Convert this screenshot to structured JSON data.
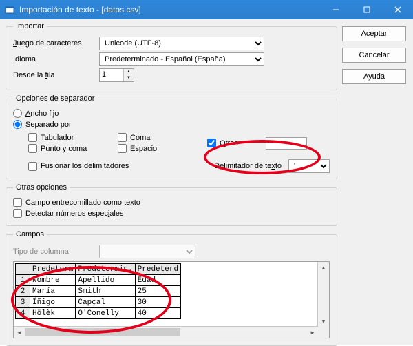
{
  "title": "Importación de texto - [datos.csv]",
  "buttons": {
    "accept": "Aceptar",
    "cancel": "Cancelar",
    "help": "Ayuda"
  },
  "import": {
    "legend": "Importar",
    "charset_label": "Juego de caracteres",
    "charset_value": "Unicode (UTF-8)",
    "lang_label": "Idioma",
    "lang_value": "Predeterminado - Español (España)",
    "fromrow_label": "Desde la fila",
    "fromrow_value": "1"
  },
  "sep": {
    "legend": "Opciones de separador",
    "fixed": "Ancho fijo",
    "by": "Separado por",
    "tab": "Tabulador",
    "comma": "Coma",
    "others": "Otros",
    "others_value": "~",
    "semicolon": "Punto y coma",
    "space": "Espacio",
    "merge": "Fusionar los delimitadores",
    "textdelim_label": "Delimitador de texto",
    "textdelim_value": "'"
  },
  "other": {
    "legend": "Otras opciones",
    "quoted": "Campo entrecomillado como texto",
    "special": "Detectar números especiales"
  },
  "fields": {
    "legend": "Campos",
    "coltype_label": "Tipo de columna",
    "headers": [
      "Predeterm",
      "Predetermin.",
      "Predeterd"
    ],
    "rows": [
      [
        "1",
        "Nombre",
        "Apellido",
        "Edad"
      ],
      [
        "2",
        "María",
        "Smith",
        "25"
      ],
      [
        "3",
        "Íñigo",
        "Capçal",
        "30"
      ],
      [
        "4",
        "Hölèk",
        "O'Conelly",
        "40"
      ]
    ]
  }
}
